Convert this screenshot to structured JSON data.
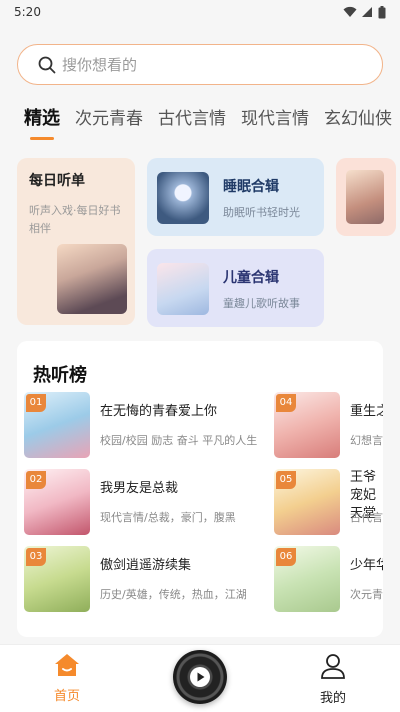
{
  "status_bar": {
    "time": "5:20"
  },
  "search": {
    "placeholder": "搜你想看的"
  },
  "tabs": [
    {
      "label": "精选",
      "active": true
    },
    {
      "label": "次元青春"
    },
    {
      "label": "古代言情"
    },
    {
      "label": "现代言情"
    },
    {
      "label": "玄幻仙侠"
    }
  ],
  "cards": {
    "daily": {
      "title": "每日听单",
      "subtitle": "听声入戏·每日好书相伴"
    },
    "sleep": {
      "title": "睡眠合辑",
      "subtitle": "助眠听书轻时光"
    },
    "kids": {
      "title": "儿童合辑",
      "subtitle": "童趣儿歌听故事"
    }
  },
  "ranking": {
    "title": "热听榜",
    "items": [
      {
        "rank": "01",
        "title": "在无悔的青春爱上你",
        "tags": "校园/校园 励志 奋斗 平凡的人生"
      },
      {
        "rank": "02",
        "title": "我男友是总裁",
        "tags": "现代言情/总裁，豪门，腹黑"
      },
      {
        "rank": "03",
        "title": "傲剑逍遥游续集",
        "tags": "历史/英雄，传统，热血，江湖"
      },
      {
        "rank": "04",
        "title": "重生之",
        "tags": "幻想言"
      },
      {
        "rank": "05",
        "title": "王爷宠妃天堂",
        "tags": "古代言"
      },
      {
        "rank": "06",
        "title": "少年华",
        "tags": "次元青"
      }
    ]
  },
  "bottom_nav": {
    "home": "首页",
    "mine": "我的"
  },
  "colors": {
    "accent": "#f58a2c",
    "search_border": "#f2b48a"
  }
}
